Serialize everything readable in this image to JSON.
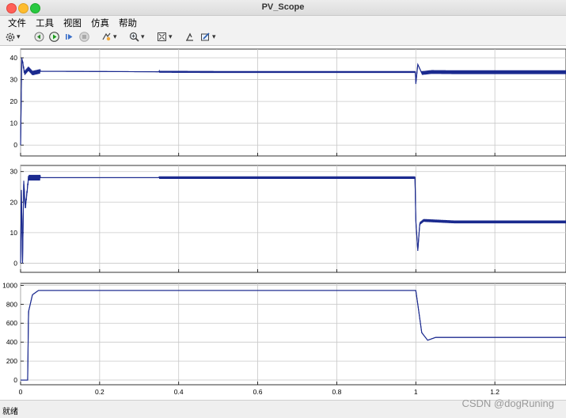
{
  "window": {
    "title": "PV_Scope"
  },
  "menu": [
    "文件",
    "工具",
    "视图",
    "仿真",
    "帮助"
  ],
  "toolbar": [
    {
      "name": "gear-icon",
      "dropdown": true
    },
    {
      "name": "step-back-icon",
      "dropdown": false
    },
    {
      "name": "run-icon",
      "dropdown": false
    },
    {
      "name": "step-forward-icon",
      "dropdown": false
    },
    {
      "name": "stop-icon",
      "dropdown": false
    },
    {
      "name": "highlight-icon",
      "dropdown": true
    },
    {
      "name": "zoom-icon",
      "dropdown": true
    },
    {
      "name": "autoscale-icon",
      "dropdown": true
    },
    {
      "name": "cursor-measure-icon",
      "dropdown": false
    },
    {
      "name": "style-icon",
      "dropdown": true
    }
  ],
  "colors": {
    "trace": "#1b2a8f",
    "grid": "#c8c8c8",
    "axis": "#000000"
  },
  "status": {
    "text": "就绪"
  },
  "watermark": "CSDN @dogRuning",
  "chart_data": [
    {
      "type": "line",
      "title": "",
      "xlim": [
        0,
        1.38
      ],
      "ylim": [
        -5,
        44
      ],
      "yticks": [
        "40",
        "30",
        "20",
        "10",
        "0"
      ],
      "series": [
        {
          "x": [
            0,
            0.003,
            0.01,
            0.02,
            0.03,
            0.05,
            0.1,
            0.35,
            0.5,
            0.999,
            1.0,
            1.005,
            1.015,
            1.04,
            1.1,
            1.38
          ],
          "y": [
            0,
            40,
            33,
            35,
            33,
            33.8,
            33.8,
            33.6,
            33.5,
            33.5,
            28,
            37,
            33,
            33.5,
            33.4,
            33.4
          ],
          "ripple": [
            {
              "from": 0.005,
              "to": 0.05,
              "amp": 2.0
            },
            {
              "from": 0.35,
              "to": 1.0,
              "amp": 0.8
            },
            {
              "from": 1.015,
              "to": 1.38,
              "amp": 1.7
            }
          ]
        }
      ]
    },
    {
      "type": "line",
      "title": "",
      "xlim": [
        0,
        1.38
      ],
      "ylim": [
        -3,
        32
      ],
      "yticks": [
        "30",
        "20",
        "10",
        "0"
      ],
      "series": [
        {
          "x": [
            0,
            0.002,
            0.005,
            0.008,
            0.012,
            0.02,
            0.04,
            0.35,
            0.998,
            1.0,
            1.005,
            1.01,
            1.02,
            1.1,
            1.38
          ],
          "y": [
            0,
            24,
            0,
            27,
            18,
            28,
            28,
            28,
            28,
            14,
            4,
            13,
            14,
            13.5,
            13.5
          ],
          "ripple": [
            {
              "from": 0.01,
              "to": 0.05,
              "amp": 1.8
            },
            {
              "from": 0.35,
              "to": 0.998,
              "amp": 0.8
            },
            {
              "from": 1.01,
              "to": 1.38,
              "amp": 0.9
            }
          ]
        }
      ]
    },
    {
      "type": "line",
      "title": "",
      "xlim": [
        0,
        1.38
      ],
      "ylim": [
        -50,
        1020
      ],
      "yticks": [
        "1000",
        "800",
        "600",
        "400",
        "200",
        "0"
      ],
      "xticks": [
        "0",
        "0.2",
        "0.4",
        "0.6",
        "0.8",
        "1",
        "1.2"
      ],
      "series": [
        {
          "x": [
            0,
            0.018,
            0.02,
            0.03,
            0.045,
            0.07,
            1.0,
            1.005,
            1.015,
            1.03,
            1.05,
            1.38
          ],
          "y": [
            0,
            0,
            720,
            900,
            945,
            945,
            945,
            800,
            500,
            420,
            450,
            450
          ],
          "ripple": []
        }
      ]
    }
  ]
}
